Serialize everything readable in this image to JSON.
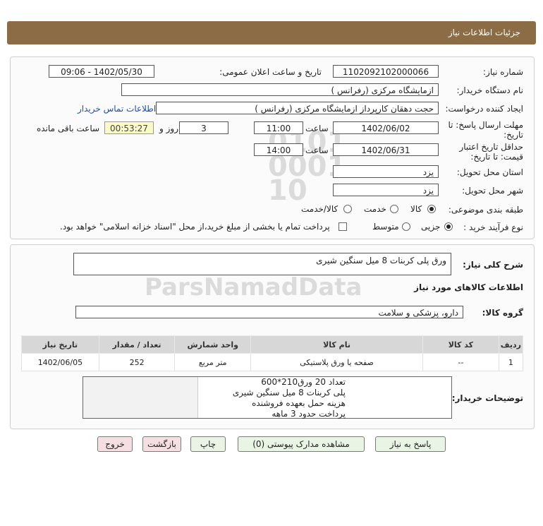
{
  "header": {
    "title": "جزئیات اطلاعات نیاز"
  },
  "fields": {
    "need_number_label": "شماره نیاز:",
    "need_number": "1102092102000066",
    "announce_label": "تاریخ و ساعت اعلان عمومی:",
    "announce_value": "1402/05/30 - 09:06",
    "buyer_org_label": "نام دستگاه خریدار:",
    "buyer_org": "ازمایشگاه مرکزی (رفرانس )",
    "requester_label": "ایجاد کننده درخواست:",
    "requester": "حجت دهقان کارپرداز ازمایشگاه مرکزی (رفرانس )",
    "contact_link": "اطلاعات تماس خریدار",
    "deadline_label_1": "مهلت ارسال پاسخ: تا",
    "deadline_label_2": "تاریخ:",
    "deadline_date": "1402/06/02",
    "time_label": "ساعت",
    "deadline_time": "11:00",
    "days_value": "3",
    "days_label": "روز و",
    "remaining_time": "00:53:27",
    "remaining_label": "ساعت باقی مانده",
    "validity_label_1": "حداقل تاریخ اعتبار",
    "validity_label_2": "قیمت: تا تاریخ:",
    "validity_date": "1402/06/31",
    "validity_time_label": "ساعت",
    "validity_time": "14:00",
    "province_label": "استان محل تحویل:",
    "province": "یزد",
    "city_label": "شهر محل تحویل:",
    "city": "یزد",
    "category_label": "طبقه بندی موضوعی:",
    "category_options": [
      "کالا",
      "خدمت",
      "کالا/خدمت"
    ],
    "purchase_type_label": "نوع فرآیند خرید :",
    "purchase_options": [
      "جزیی",
      "متوسط"
    ],
    "treasury_note": "پرداخت تمام یا بخشی از مبلغ خرید،از محل \"اسناد خزانه اسلامی\" خواهد بود."
  },
  "summary": {
    "label": "شرح کلی نیاز:",
    "value": "ورق پلی کربنات 8 میل سنگین شیری",
    "goods_info_title": "اطلاعات کالاهای مورد نیاز",
    "goods_group_label": "گروه کالا:",
    "goods_group": "دارو، پزشکی و سلامت"
  },
  "table": {
    "headers": [
      "ردیف",
      "کد کالا",
      "نام کالا",
      "واحد شمارش",
      "تعداد / مقدار",
      "تاریخ نیاز"
    ],
    "rows": [
      [
        "1",
        "--",
        "صفحه یا ورق پلاستیکی",
        "متر مربع",
        "252",
        "1402/06/05"
      ]
    ]
  },
  "notes": {
    "label": "توضیحات خریدار:",
    "lines": [
      "تعداد 20 ورق210*600",
      "پلی کربنات 8 میل سنگین شیری",
      "هزینه حمل بعهده فروشنده",
      "پرداخت حدود 3 ماهه"
    ]
  },
  "buttons": {
    "reply": "پاسخ به نیاز",
    "docs": "مشاهده مدارک پیوستی (0)",
    "print": "چاپ",
    "back": "بازگشت",
    "exit": "خروج"
  }
}
